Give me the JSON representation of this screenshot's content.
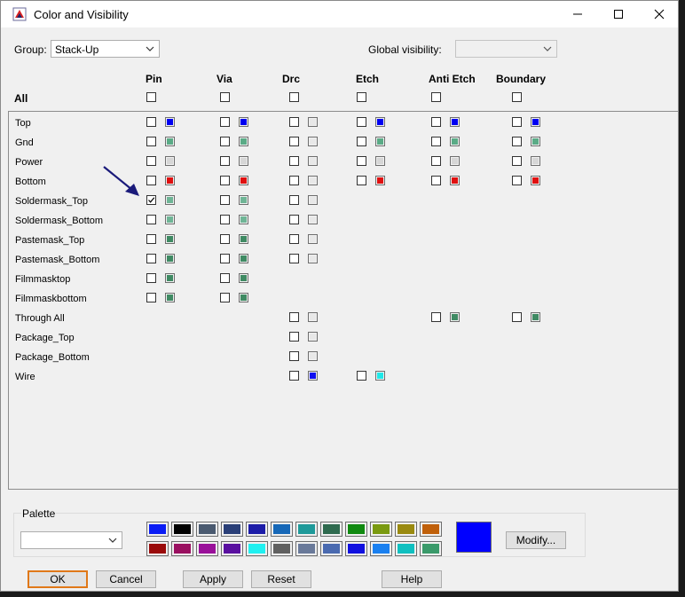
{
  "window": {
    "title": "Color and Visibility"
  },
  "top": {
    "group_label": "Group:",
    "group_value": "Stack-Up",
    "global_visibility_label": "Global visibility:",
    "global_visibility_value": ""
  },
  "header": {
    "all_label": "All"
  },
  "columns": [
    "Pin",
    "Via",
    "Drc",
    "Etch",
    "Anti Etch",
    "Boundary"
  ],
  "rows": [
    {
      "label": "Top",
      "cells": [
        {
          "col": 0,
          "checked": false,
          "color": "#0000f2"
        },
        {
          "col": 1,
          "checked": false,
          "color": "#0000f2"
        },
        {
          "col": 2,
          "checked": false,
          "color": "#e8e8e8"
        },
        {
          "col": 3,
          "checked": false,
          "color": "#0000f2"
        },
        {
          "col": 4,
          "checked": false,
          "color": "#0000f2"
        },
        {
          "col": 5,
          "checked": false,
          "color": "#0000f2"
        }
      ]
    },
    {
      "label": "Gnd",
      "cells": [
        {
          "col": 0,
          "checked": false,
          "color": "#5aab86"
        },
        {
          "col": 1,
          "checked": false,
          "color": "#5aab86"
        },
        {
          "col": 2,
          "checked": false,
          "color": "#e8e8e8"
        },
        {
          "col": 3,
          "checked": false,
          "color": "#5aab86"
        },
        {
          "col": 4,
          "checked": false,
          "color": "#5aab86"
        },
        {
          "col": 5,
          "checked": false,
          "color": "#5aab86"
        }
      ]
    },
    {
      "label": "Power",
      "cells": [
        {
          "col": 0,
          "checked": false,
          "color": "#d6d6d6"
        },
        {
          "col": 1,
          "checked": false,
          "color": "#d6d6d6"
        },
        {
          "col": 2,
          "checked": false,
          "color": "#e8e8e8"
        },
        {
          "col": 3,
          "checked": false,
          "color": "#d6d6d6"
        },
        {
          "col": 4,
          "checked": false,
          "color": "#d6d6d6"
        },
        {
          "col": 5,
          "checked": false,
          "color": "#d6d6d6"
        }
      ]
    },
    {
      "label": "Bottom",
      "cells": [
        {
          "col": 0,
          "checked": false,
          "color": "#e01010"
        },
        {
          "col": 1,
          "checked": false,
          "color": "#e01010"
        },
        {
          "col": 2,
          "checked": false,
          "color": "#e8e8e8"
        },
        {
          "col": 3,
          "checked": false,
          "color": "#e01010"
        },
        {
          "col": 4,
          "checked": false,
          "color": "#e01010"
        },
        {
          "col": 5,
          "checked": false,
          "color": "#e01010"
        }
      ]
    },
    {
      "label": "Soldermask_Top",
      "cells": [
        {
          "col": 0,
          "checked": true,
          "color": "#6fb596"
        },
        {
          "col": 1,
          "checked": false,
          "color": "#6fb596"
        },
        {
          "col": 2,
          "checked": false,
          "color": "#e8e8e8"
        }
      ]
    },
    {
      "label": "Soldermask_Bottom",
      "cells": [
        {
          "col": 0,
          "checked": false,
          "color": "#6fb596"
        },
        {
          "col": 1,
          "checked": false,
          "color": "#6fb596"
        },
        {
          "col": 2,
          "checked": false,
          "color": "#e8e8e8"
        }
      ]
    },
    {
      "label": "Pastemask_Top",
      "cells": [
        {
          "col": 0,
          "checked": false,
          "color": "#3f8a63"
        },
        {
          "col": 1,
          "checked": false,
          "color": "#3f8a63"
        },
        {
          "col": 2,
          "checked": false,
          "color": "#e8e8e8"
        }
      ]
    },
    {
      "label": "Pastemask_Bottom",
      "cells": [
        {
          "col": 0,
          "checked": false,
          "color": "#3f8a63"
        },
        {
          "col": 1,
          "checked": false,
          "color": "#3f8a63"
        },
        {
          "col": 2,
          "checked": false,
          "color": "#e8e8e8"
        }
      ]
    },
    {
      "label": "Filmmasktop",
      "cells": [
        {
          "col": 0,
          "checked": false,
          "color": "#3f8a63"
        },
        {
          "col": 1,
          "checked": false,
          "color": "#3f8a63"
        }
      ]
    },
    {
      "label": "Filmmaskbottom",
      "cells": [
        {
          "col": 0,
          "checked": false,
          "color": "#3f8a63"
        },
        {
          "col": 1,
          "checked": false,
          "color": "#3f8a63"
        }
      ]
    },
    {
      "label": "Through All",
      "cells": [
        {
          "col": 2,
          "checked": false,
          "color": "#e8e8e8"
        },
        {
          "col": 4,
          "checked": false,
          "color": "#3f8a63"
        },
        {
          "col": 5,
          "checked": false,
          "color": "#3f8a63"
        }
      ]
    },
    {
      "label": "Package_Top",
      "cells": [
        {
          "col": 2,
          "checked": false,
          "color": "#e8e8e8"
        }
      ]
    },
    {
      "label": "Package_Bottom",
      "cells": [
        {
          "col": 2,
          "checked": false,
          "color": "#e8e8e8"
        }
      ]
    },
    {
      "label": "Wire",
      "cells": [
        {
          "col": 2,
          "checked": false,
          "color": "#1010f0"
        },
        {
          "col": 3,
          "checked": false,
          "color": "#20e8e8"
        }
      ]
    }
  ],
  "palette": {
    "label": "Palette",
    "dropdown_value": "",
    "row1": [
      "#0a1cf5",
      "#000000",
      "#4a5a70",
      "#2a3f78",
      "#1c1ca8",
      "#1668b8",
      "#1f9a9a",
      "#2f6b4f",
      "#108a10",
      "#7a9a10",
      "#9a8a10",
      "#c0600a"
    ],
    "row2": [
      "#9a0a0a",
      "#9a1060",
      "#9a109a",
      "#5a10a0",
      "#20f0f0",
      "#606060",
      "#6a7a9a",
      "#4a6ab0",
      "#1010e0",
      "#1a80f0",
      "#10c0c0",
      "#3a9a6a"
    ],
    "current_color": "#0000ff",
    "modify_label": "Modify..."
  },
  "buttons": {
    "ok": "OK",
    "cancel": "Cancel",
    "apply": "Apply",
    "reset": "Reset",
    "help": "Help"
  }
}
